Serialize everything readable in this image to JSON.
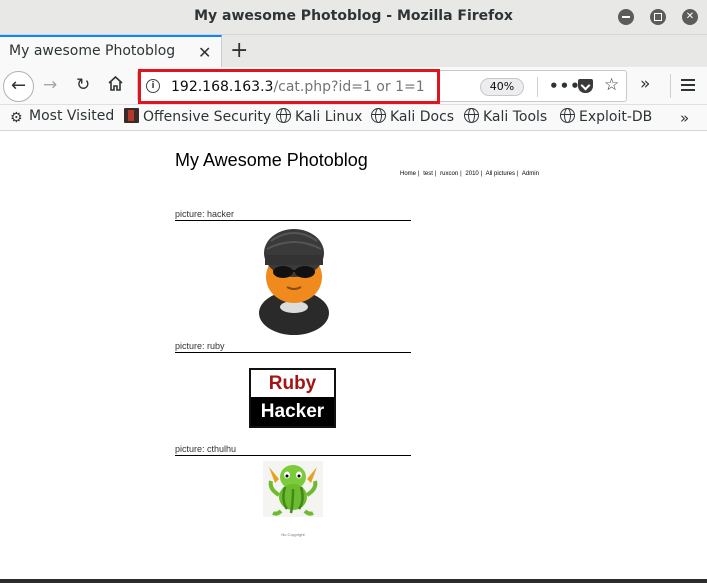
{
  "window": {
    "title": "My awesome Photoblog - Mozilla Firefox"
  },
  "tab": {
    "title": "My awesome Photoblog"
  },
  "url": {
    "host": "192.168.163.3",
    "path": "/cat.php?id=1 or 1=1",
    "zoom": "40%"
  },
  "bookmarks": [
    {
      "label": "Most Visited",
      "icon": "gear-icon"
    },
    {
      "label": "Offensive Security",
      "icon": "offsec-icon"
    },
    {
      "label": "Kali Linux",
      "icon": "globe-icon"
    },
    {
      "label": "Kali Docs",
      "icon": "globe-icon"
    },
    {
      "label": "Kali Tools",
      "icon": "globe-icon"
    },
    {
      "label": "Exploit-DB",
      "icon": "globe-icon"
    }
  ],
  "page": {
    "title": "My Awesome Photoblog",
    "nav": [
      "Home",
      "test",
      "ruxcon",
      "2010",
      "All pictures",
      "Admin"
    ],
    "picture_prefix": "picture:",
    "pictures": [
      {
        "name": "hacker"
      },
      {
        "name": "ruby",
        "image_text_line1": "Ruby",
        "image_text_line2": "Hacker"
      },
      {
        "name": "cthulhu"
      }
    ],
    "footer": "No Copyright"
  },
  "colors": {
    "tab_accent": "#0a84ff",
    "highlight_box": "#e0141c",
    "ruby_red": "#a31515"
  }
}
